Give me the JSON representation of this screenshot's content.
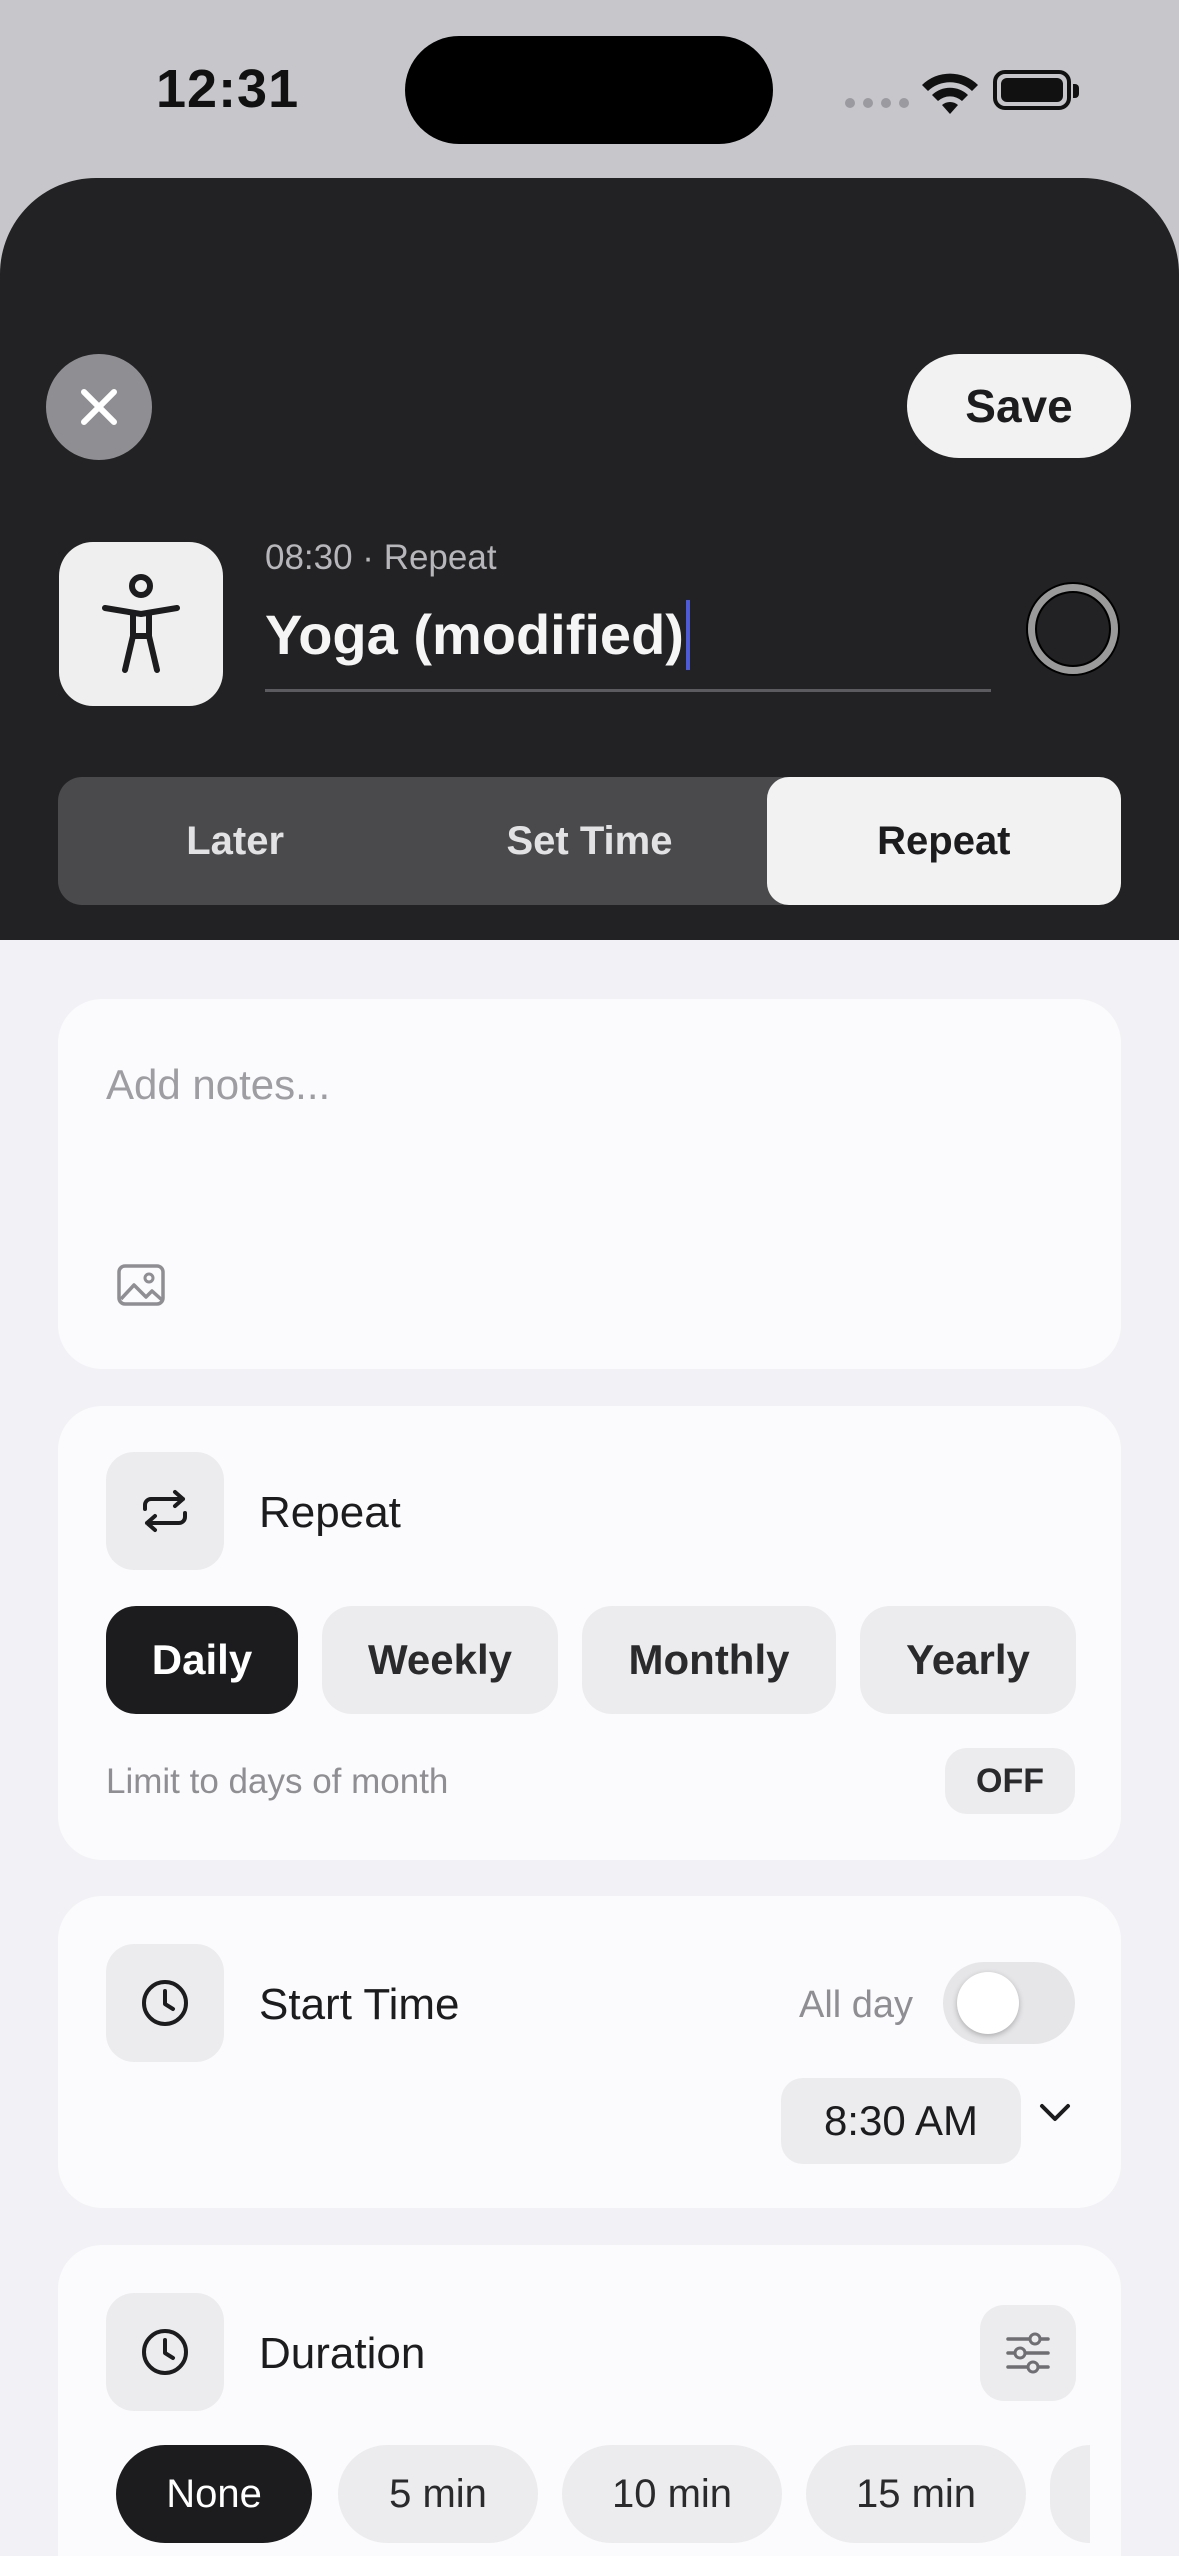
{
  "status_bar": {
    "time": "12:31"
  },
  "header": {
    "close_icon": "close-icon",
    "save_label": "Save",
    "task_icon": "accessibility-person-icon",
    "subtitle": "08:30 · Repeat",
    "title_value": "Yoga (modified)"
  },
  "segment": {
    "options": [
      "Later",
      "Set Time",
      "Repeat"
    ],
    "selected": "Repeat"
  },
  "notes": {
    "placeholder": "Add notes..."
  },
  "repeat": {
    "label": "Repeat",
    "options": [
      "Daily",
      "Weekly",
      "Monthly",
      "Yearly"
    ],
    "selected": "Daily",
    "limit_label": "Limit to days of month",
    "limit_value": "OFF"
  },
  "start_time": {
    "label": "Start Time",
    "all_day_label": "All day",
    "all_day_on": false,
    "time_value": "8:30 AM"
  },
  "duration": {
    "label": "Duration",
    "options": [
      "None",
      "5 min",
      "10 min",
      "15 min"
    ],
    "selected": "None"
  },
  "colors": {
    "sheet_dark": "#222224",
    "background": "#f2f2f6",
    "chip_active": "#1c1c1e",
    "caret": "#4f5bd5"
  }
}
